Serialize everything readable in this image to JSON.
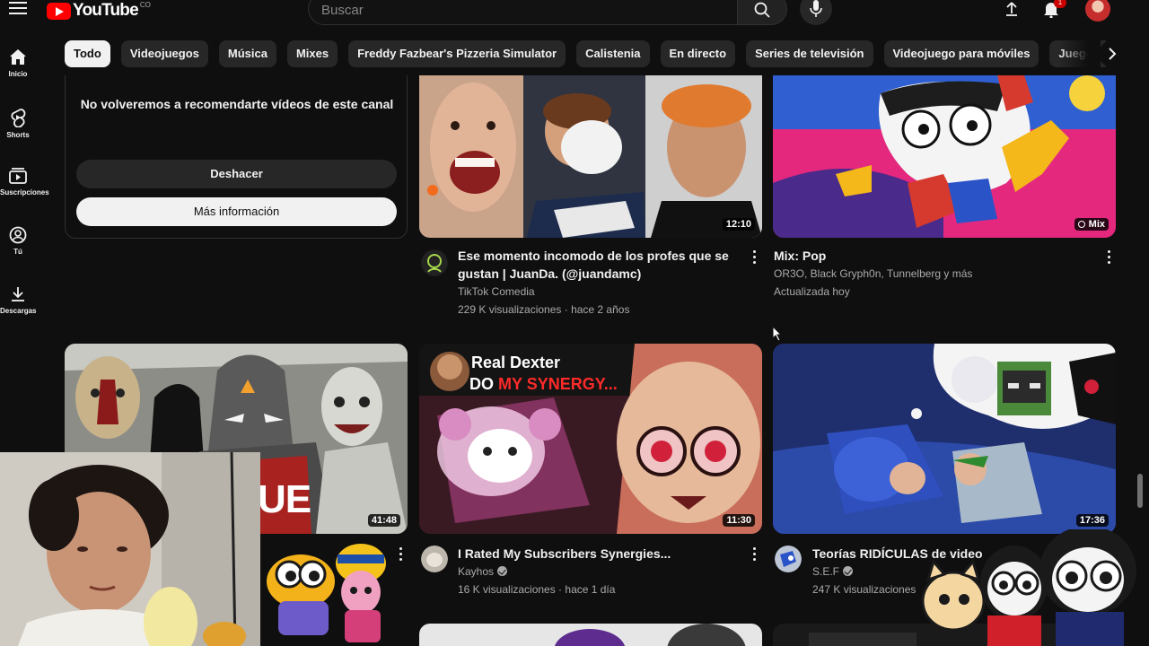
{
  "header": {
    "logo_text": "YouTube",
    "logo_suffix": "CO",
    "search_placeholder": "Buscar",
    "notification_count": "1"
  },
  "chips": [
    "Todo",
    "Videojuegos",
    "Música",
    "Mixes",
    "Freddy Fazbear's Pizzeria Simulator",
    "Calistenia",
    "En directo",
    "Series de televisión",
    "Videojuego para móviles",
    "Juegos de acción y aventura"
  ],
  "sidebar": {
    "items": [
      {
        "label": "Inicio",
        "icon": "home-icon"
      },
      {
        "label": "Shorts",
        "icon": "shorts-icon"
      },
      {
        "label": "Suscripciones",
        "icon": "subscriptions-icon"
      },
      {
        "label": "Tú",
        "icon": "you-icon"
      },
      {
        "label": "Descargas",
        "icon": "download-icon"
      }
    ]
  },
  "notice": {
    "text": "No volveremos a recomendarte vídeos de este canal",
    "undo_label": "Deshacer",
    "more_label": "Más información"
  },
  "videos": [
    {
      "title_line1": "Ese momento incomodo de los profes que se",
      "title_line2": "gustan | JuanDa. (@juandamc)",
      "channel": "TikTok Comedia",
      "stats": "229 K visualizaciones · hace 2 años",
      "duration": "12:10"
    },
    {
      "title_line1": "Mix: Pop",
      "channel": "OR3O, Black Gryph0n, Tunnelberg y más",
      "stats": "Actualizada hoy",
      "badge": "Mix"
    },
    {
      "title_line1": "",
      "duration": "41:48",
      "thumb_text": "UE"
    },
    {
      "title_line1": "I Rated My Subscribers Synergies...",
      "channel": "Kayhos",
      "stats": "16 K visualizaciones · hace 1 día",
      "duration": "11:30",
      "thumb_line1": "Real Dexter",
      "thumb_line2a": "DO ",
      "thumb_line2b": "MY SYNERGY..."
    },
    {
      "title_line1": "Teorías RIDÍCULAS de video",
      "channel": "S.E.F",
      "stats": "247 K visualizaciones",
      "duration": "17:36"
    }
  ],
  "colors": {
    "background": "#0f0f0f",
    "chip": "#272727",
    "brand_red": "#ff0000",
    "text": "#f1f1f1",
    "meta": "#aaaaaa"
  }
}
